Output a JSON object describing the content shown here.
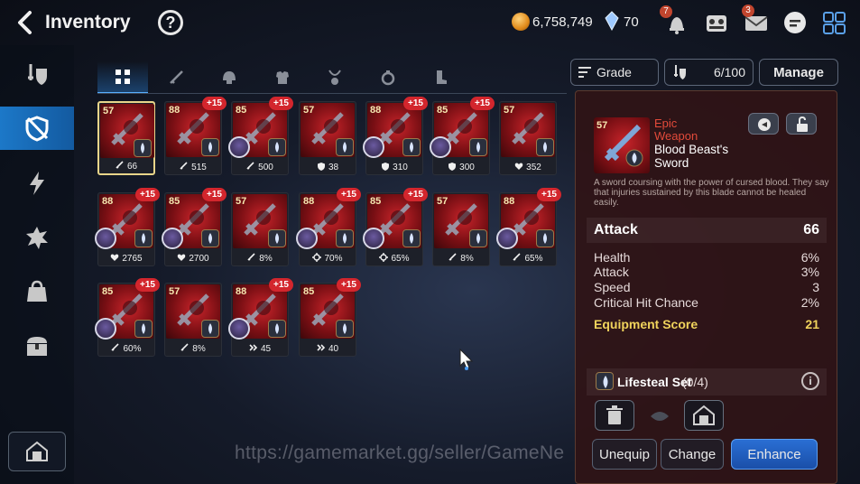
{
  "header": {
    "title": "Inventory",
    "help": "?",
    "gold": "6,758,749",
    "gems": "70",
    "bell_badge": "7",
    "mail_badge": "3",
    "icons": [
      "back-arrow-icon",
      "help-icon",
      "gold-coin-icon",
      "crystal-gem-icon",
      "bell-icon",
      "team-icon",
      "mail-icon",
      "chat-icon",
      "grid-menu-icon"
    ]
  },
  "sidebar": {
    "items": [
      {
        "icon": "sword-shield-icon",
        "active": false
      },
      {
        "icon": "shield-slash-icon",
        "active": true
      },
      {
        "icon": "lightning-icon",
        "active": false
      },
      {
        "icon": "splash-icon",
        "active": false
      },
      {
        "icon": "bag-icon",
        "active": false
      },
      {
        "icon": "chest-icon",
        "active": false
      }
    ],
    "bottom_icon": "storage-house-icon"
  },
  "tabs": [
    {
      "icon": "grid-icon",
      "active": true
    },
    {
      "icon": "sword-icon",
      "active": false
    },
    {
      "icon": "helmet-icon",
      "active": false
    },
    {
      "icon": "armor-icon",
      "active": false
    },
    {
      "icon": "necklace-icon",
      "active": false
    },
    {
      "icon": "ring-icon",
      "active": false
    },
    {
      "icon": "boots-icon",
      "active": false
    }
  ],
  "toolbar": {
    "grade_label": "Grade",
    "capacity": "6/100",
    "manage_label": "Manage"
  },
  "items": [
    {
      "level": "57",
      "plus": "",
      "stat": "66",
      "stat_icon": "attack",
      "has_avatar": false,
      "selected": true
    },
    {
      "level": "88",
      "plus": "+15",
      "stat": "515",
      "stat_icon": "attack",
      "has_avatar": false,
      "selected": false
    },
    {
      "level": "85",
      "plus": "+15",
      "stat": "500",
      "stat_icon": "attack",
      "has_avatar": true,
      "selected": false
    },
    {
      "level": "57",
      "plus": "",
      "stat": "38",
      "stat_icon": "defense",
      "has_avatar": false,
      "selected": false
    },
    {
      "level": "88",
      "plus": "+15",
      "stat": "310",
      "stat_icon": "defense",
      "has_avatar": true,
      "selected": false
    },
    {
      "level": "85",
      "plus": "+15",
      "stat": "300",
      "stat_icon": "defense",
      "has_avatar": true,
      "selected": false
    },
    {
      "level": "57",
      "plus": "",
      "stat": "352",
      "stat_icon": "health",
      "has_avatar": false,
      "selected": false
    },
    {
      "level": "88",
      "plus": "+15",
      "stat": "2765",
      "stat_icon": "health",
      "has_avatar": true,
      "selected": false
    },
    {
      "level": "85",
      "plus": "+15",
      "stat": "2700",
      "stat_icon": "health",
      "has_avatar": true,
      "selected": false
    },
    {
      "level": "57",
      "plus": "",
      "stat": "8%",
      "stat_icon": "attack",
      "has_avatar": false,
      "selected": false
    },
    {
      "level": "88",
      "plus": "+15",
      "stat": "70%",
      "stat_icon": "crit",
      "has_avatar": true,
      "selected": false
    },
    {
      "level": "85",
      "plus": "+15",
      "stat": "65%",
      "stat_icon": "crit",
      "has_avatar": true,
      "selected": false
    },
    {
      "level": "57",
      "plus": "",
      "stat": "8%",
      "stat_icon": "attack",
      "has_avatar": false,
      "selected": false
    },
    {
      "level": "88",
      "plus": "+15",
      "stat": "65%",
      "stat_icon": "attack",
      "has_avatar": true,
      "selected": false
    },
    {
      "level": "85",
      "plus": "+15",
      "stat": "60%",
      "stat_icon": "attack",
      "has_avatar": true,
      "selected": false
    },
    {
      "level": "57",
      "plus": "",
      "stat": "8%",
      "stat_icon": "attack",
      "has_avatar": false,
      "selected": false
    },
    {
      "level": "88",
      "plus": "+15",
      "stat": "45",
      "stat_icon": "speed",
      "has_avatar": true,
      "selected": false
    },
    {
      "level": "85",
      "plus": "+15",
      "stat": "40",
      "stat_icon": "speed",
      "has_avatar": false,
      "selected": false
    }
  ],
  "detail": {
    "level": "57",
    "grade": "Epic",
    "type": "Weapon",
    "name": "Blood Beast's Sword",
    "description": "A sword coursing with the power of cursed blood. They say that injuries sustained by this blade cannot be healed easily.",
    "main_stat": {
      "label": "Attack",
      "value": "66"
    },
    "sub_stats": [
      {
        "label": "Health",
        "value": "6%"
      },
      {
        "label": "Attack",
        "value": "3%"
      },
      {
        "label": "Speed",
        "value": "3"
      },
      {
        "label": "Critical Hit Chance",
        "value": "2%"
      }
    ],
    "score": {
      "label": "Equipment Score",
      "value": "21"
    },
    "set": {
      "name": "Lifesteal Set",
      "count": "(0/4)"
    },
    "buttons": {
      "unequip": "Unequip",
      "change": "Change",
      "enhance": "Enhance"
    }
  },
  "watermark": "https://gamemarket.gg/seller/GameNe",
  "colors": {
    "accent": "#1c78c8",
    "epic": "#e24a3a",
    "score": "#f0d35c",
    "item_bg": "#7a0f14"
  }
}
